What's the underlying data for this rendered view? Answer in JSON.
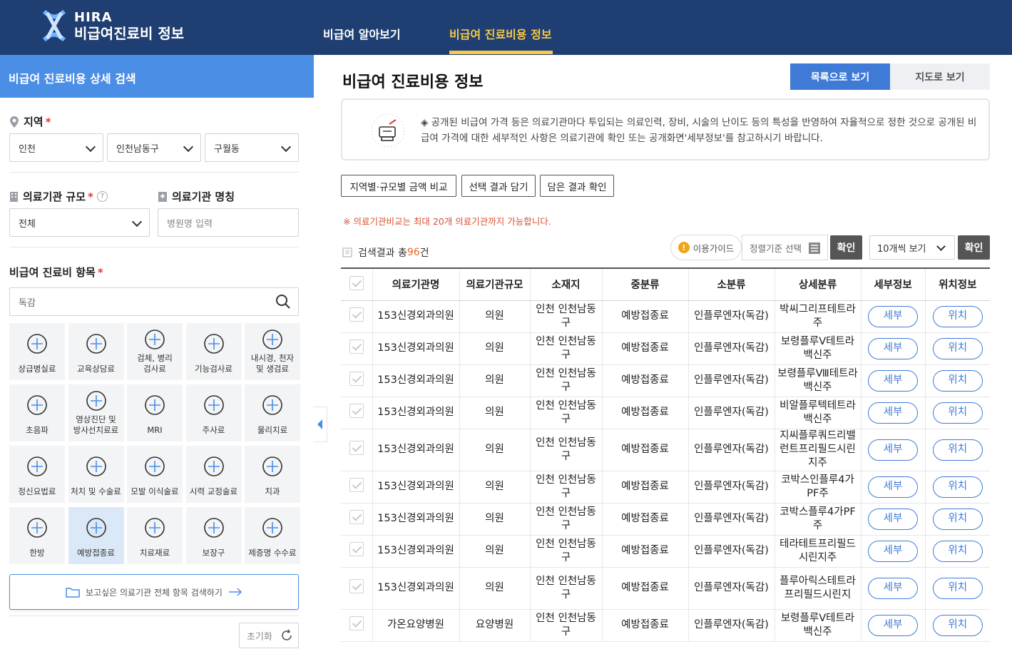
{
  "header": {
    "logo_line1": "HIRA",
    "logo_line2": "비급여진료비 정보",
    "nav": [
      "비급여 알아보기",
      "비급여 진료비용 정보"
    ],
    "colors": {
      "bar": "#1f3f72",
      "active": "#f7c84a"
    }
  },
  "sidebar": {
    "title": "비급여 진료비용 상세 검색",
    "region": {
      "label": "지역",
      "required": "*",
      "city": "인천",
      "district": "인천남동구",
      "dong": "구월동"
    },
    "scale": {
      "label": "의료기관 규모",
      "required": "*",
      "help": "?",
      "value": "전체"
    },
    "name": {
      "label": "의료기관 명칭",
      "placeholder": "병원명 입력"
    },
    "items": {
      "label": "비급여 진료비 항목",
      "required": "*",
      "search_value": "독감"
    },
    "categories": [
      {
        "label": "상급병실료",
        "icon": "hospital-bed-icon"
      },
      {
        "label": "교육상담료",
        "icon": "counseling-icon"
      },
      {
        "label": "검체, 병리\n검사료",
        "icon": "pathology-icon"
      },
      {
        "label": "기능검사료",
        "icon": "function-test-icon"
      },
      {
        "label": "내시경, 천자\n및 생검료",
        "icon": "endoscope-icon"
      },
      {
        "label": "초음파",
        "icon": "ultrasound-icon"
      },
      {
        "label": "영상진단 및\n방사선치료료",
        "icon": "radiology-icon"
      },
      {
        "label": "MRI",
        "icon": "mri-icon"
      },
      {
        "label": "주사료",
        "icon": "syringe-icon"
      },
      {
        "label": "물리치료",
        "icon": "physical-therapy-icon"
      },
      {
        "label": "정신요법료",
        "icon": "brain-icon"
      },
      {
        "label": "처치 및 수술료",
        "icon": "surgery-icon"
      },
      {
        "label": "모발 이식술료",
        "icon": "hair-transplant-icon"
      },
      {
        "label": "시력 교정술료",
        "icon": "eye-icon"
      },
      {
        "label": "치과",
        "icon": "tooth-icon"
      },
      {
        "label": "한방",
        "icon": "acupuncture-icon"
      },
      {
        "label": "예방접종료",
        "icon": "vaccine-icon",
        "active": true
      },
      {
        "label": "치료재료",
        "icon": "material-icon"
      },
      {
        "label": "보장구",
        "icon": "wheelchair-icon"
      },
      {
        "label": "제증명 수수료",
        "icon": "certificate-icon"
      }
    ],
    "search_all": "보고싶은 의료기관 전체 항목 검색하기",
    "reset": "초기화"
  },
  "main": {
    "title": "비급여 진료비용 정보",
    "view_list": "목록으로 보기",
    "view_map": "지도로 보기",
    "notice": "◈ 공개된 비급여 가격 등은 의료기관마다 투입되는 의료인력, 장비, 시술의 난이도 등의 특성을 반영하여 자율적으로 정한 것으로 공개된 비급여 가격에 대한 세부적인 사항은 의료기관에 확인 또는 공개화면'세부정보'를 참고하시기 바랍니다.",
    "actions": [
      "지역별·규모별 금액 비교",
      "선택 결과 담기",
      "담은 결과 확인"
    ],
    "warning": "※ 의료기관비교는 최대 20개 의료기관까지 가능합니다.",
    "result_prefix": "검색결과 총",
    "result_count": "96",
    "result_suffix": "건",
    "guide": "이용가이드",
    "sort": "정렬기준 선택",
    "confirm": "확인",
    "per_page": "10개씩 보기",
    "columns": [
      "의료기관명",
      "의료기관규모",
      "소재지",
      "중분류",
      "소분류",
      "상세분류",
      "세부정보",
      "위치정보"
    ],
    "detail_label": "세부",
    "location_label": "위치",
    "rows": [
      {
        "name": "153신경외과의원",
        "scale": "의원",
        "loc": "인천 인천남동구",
        "mid": "예방접종료",
        "sub": "인플루엔자(독감)",
        "detail": "박씨그리프테트라주"
      },
      {
        "name": "153신경외과의원",
        "scale": "의원",
        "loc": "인천 인천남동구",
        "mid": "예방접종료",
        "sub": "인플루엔자(독감)",
        "detail": "보령플루Ⅴ테트라백신주"
      },
      {
        "name": "153신경외과의원",
        "scale": "의원",
        "loc": "인천 인천남동구",
        "mid": "예방접종료",
        "sub": "인플루엔자(독감)",
        "detail": "보령플루Ⅷ테트라백신주"
      },
      {
        "name": "153신경외과의원",
        "scale": "의원",
        "loc": "인천 인천남동구",
        "mid": "예방접종료",
        "sub": "인플루엔자(독감)",
        "detail": "비알플루텍테트라백신주"
      },
      {
        "name": "153신경외과의원",
        "scale": "의원",
        "loc": "인천 인천남동구",
        "mid": "예방접종료",
        "sub": "인플루엔자(독감)",
        "detail": "지씨플루쿼드리밸런트프리필드시린지주"
      },
      {
        "name": "153신경외과의원",
        "scale": "의원",
        "loc": "인천 인천남동구",
        "mid": "예방접종료",
        "sub": "인플루엔자(독감)",
        "detail": "코박스인플루4가PF주"
      },
      {
        "name": "153신경외과의원",
        "scale": "의원",
        "loc": "인천 인천남동구",
        "mid": "예방접종료",
        "sub": "인플루엔자(독감)",
        "detail": "코박스플루4가PF주"
      },
      {
        "name": "153신경외과의원",
        "scale": "의원",
        "loc": "인천 인천남동구",
        "mid": "예방접종료",
        "sub": "인플루엔자(독감)",
        "detail": "테라테트프리필드시린지주"
      },
      {
        "name": "153신경외과의원",
        "scale": "의원",
        "loc": "인천 인천남동구",
        "mid": "예방접종료",
        "sub": "인플루엔자(독감)",
        "detail": "플루아릭스테트라프리필드시린지"
      },
      {
        "name": "가온요양병원",
        "scale": "요양병원",
        "loc": "인천 인천남동구",
        "mid": "예방접종료",
        "sub": "인플루엔자(독감)",
        "detail": "보령플루Ⅴ테트라백신주"
      }
    ]
  }
}
